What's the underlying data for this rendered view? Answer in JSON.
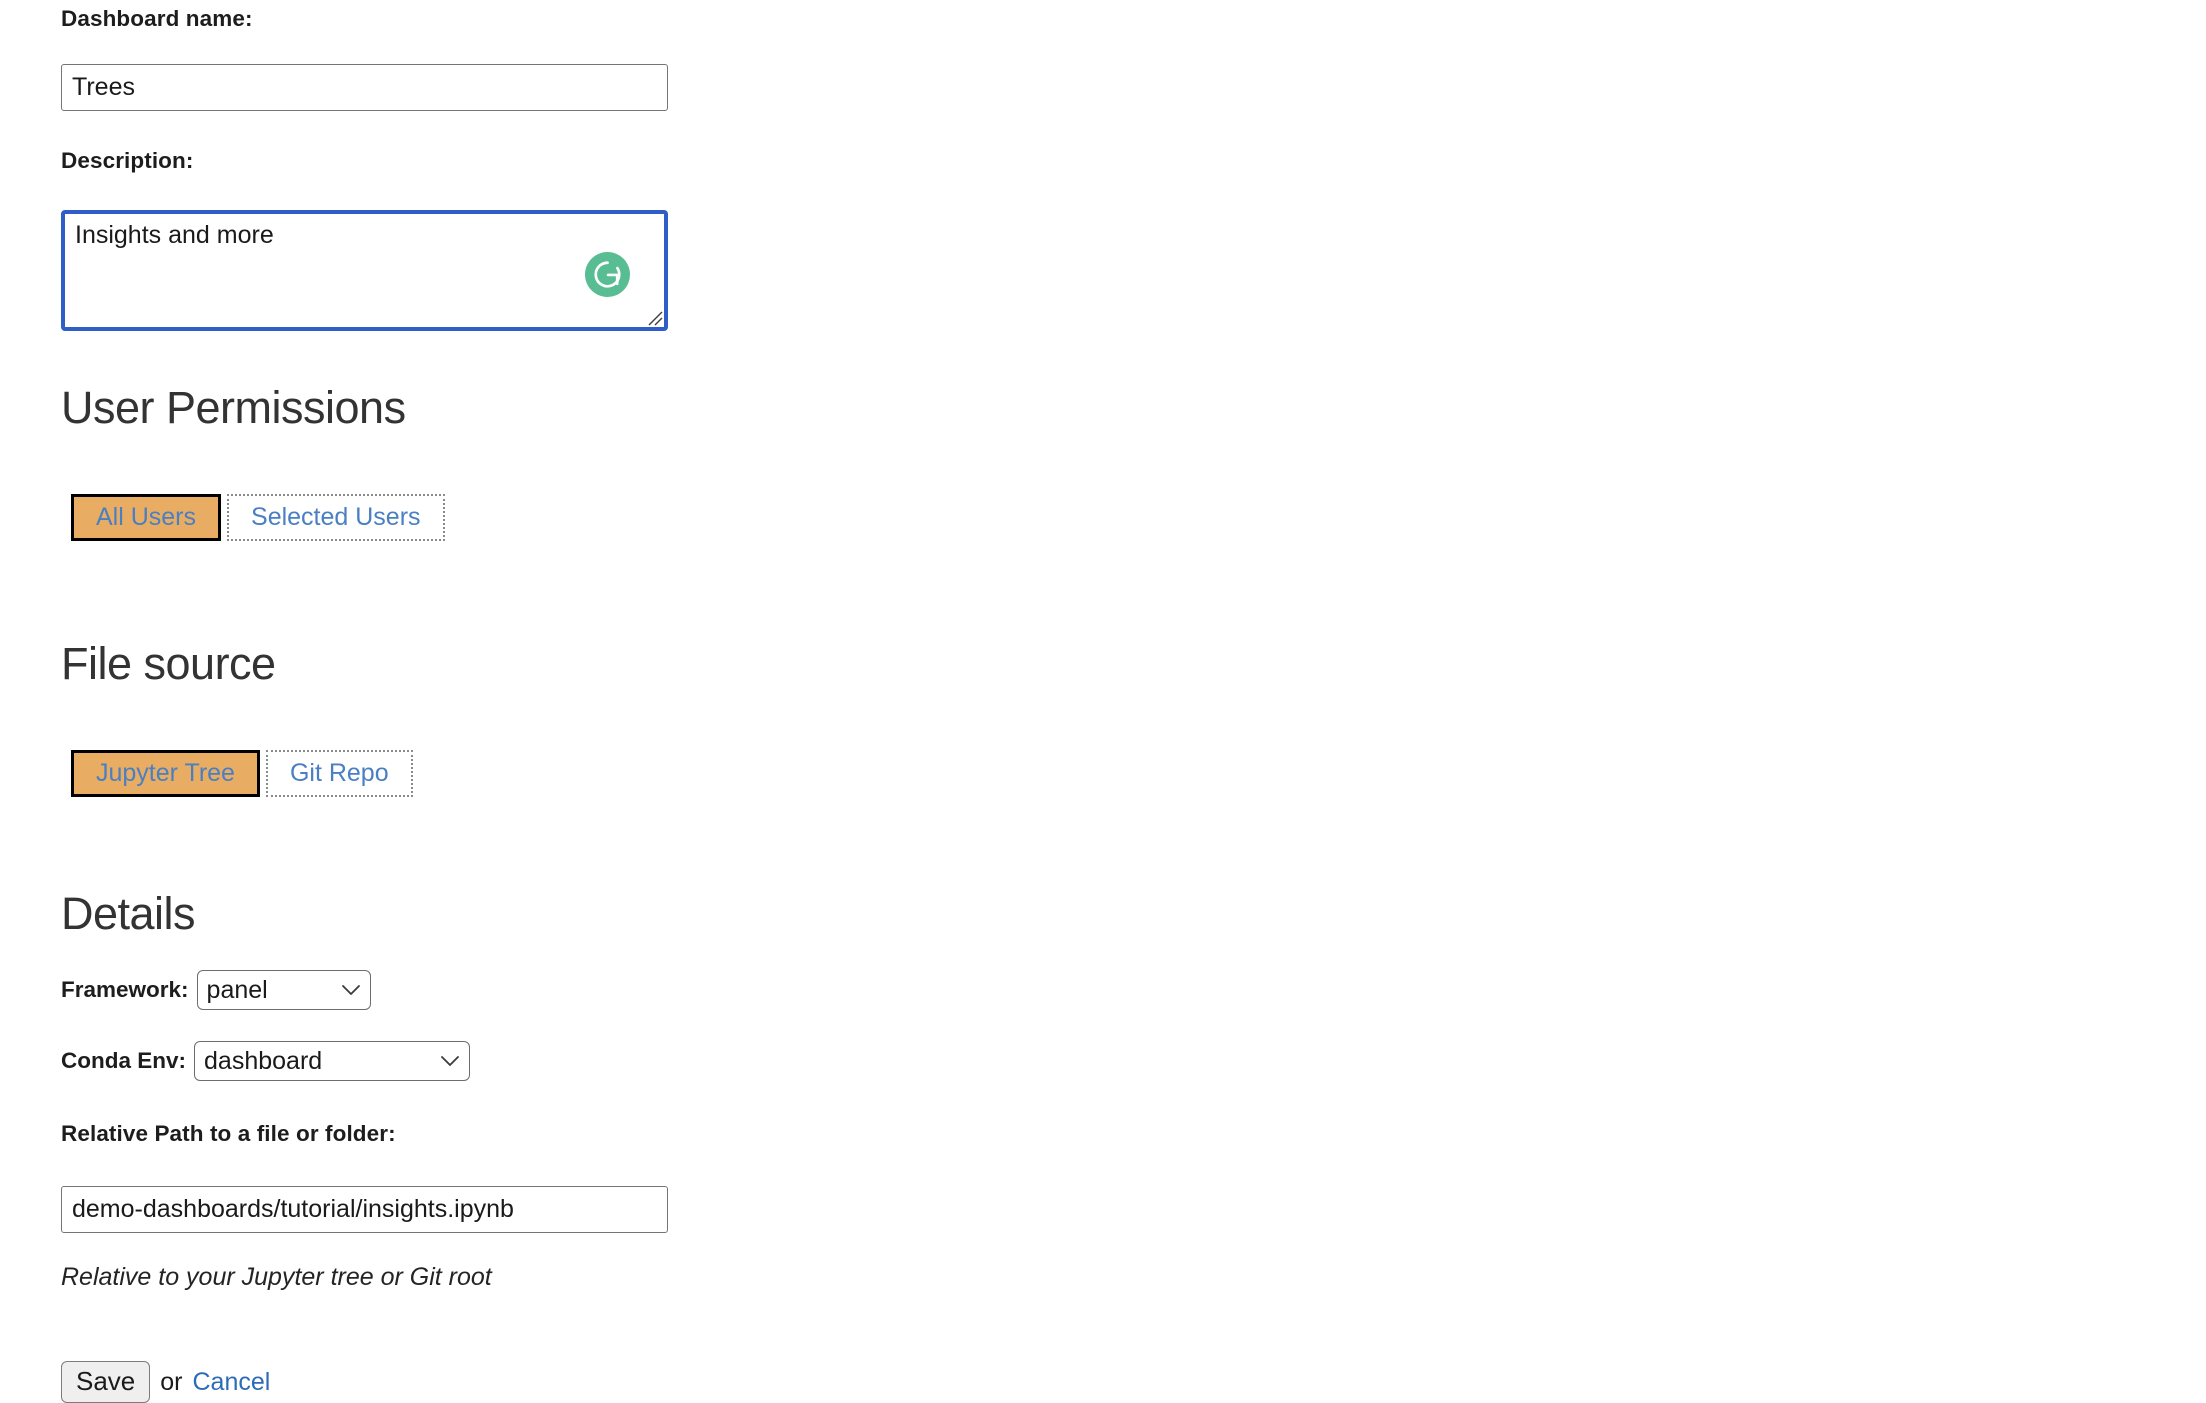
{
  "form": {
    "dashboard_name": {
      "label": "Dashboard name:",
      "value": "Trees",
      "placeholder": ""
    },
    "description": {
      "label": "Description:",
      "value": "Insights and more",
      "placeholder": "",
      "assistant_icon": "grammarly-icon",
      "focus_color": "#2f5fc6"
    }
  },
  "user_permissions": {
    "heading": "User Permissions",
    "options": [
      {
        "label": "All Users",
        "selected": true
      },
      {
        "label": "Selected Users",
        "selected": false
      }
    ],
    "selected_color": "#e8ad63",
    "text_color": "#4a7fc1"
  },
  "file_source": {
    "heading": "File source",
    "options": [
      {
        "label": "Jupyter Tree",
        "selected": true
      },
      {
        "label": "Git Repo",
        "selected": false
      }
    ]
  },
  "details": {
    "heading": "Details",
    "framework": {
      "label": "Framework:",
      "value": "panel",
      "icon": "chevron-down-icon"
    },
    "conda_env": {
      "label": "Conda Env:",
      "value": "dashboard",
      "icon": "chevron-down-icon"
    },
    "relative_path": {
      "label": "Relative Path to a file or folder:",
      "value": "demo-dashboards/tutorial/insights.ipynb",
      "placeholder": "",
      "helper": "Relative to your Jupyter tree or Git root"
    }
  },
  "actions": {
    "save_label": "Save",
    "or_label": "or",
    "cancel_label": "Cancel",
    "cancel_color": "#2b6cb8"
  }
}
